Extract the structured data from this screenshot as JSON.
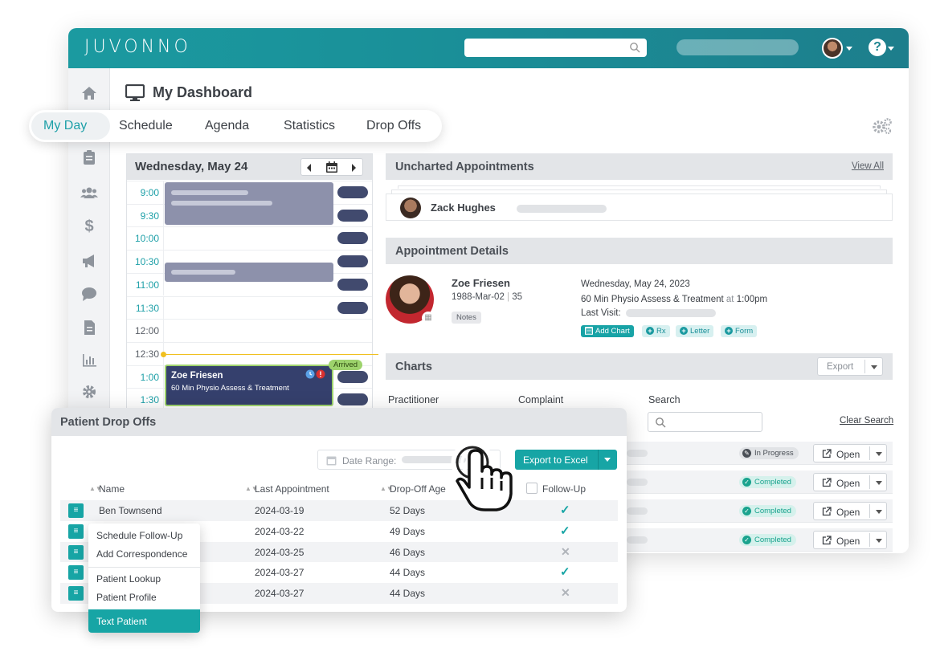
{
  "app": {
    "brand": "JUVONNO",
    "page_title": "My Dashboard",
    "sidebar_icons": [
      "home-icon",
      "calendar-icon",
      "clipboard-icon",
      "users-icon",
      "dollar-icon",
      "megaphone-icon",
      "chat-icon",
      "document-icon",
      "chart-icon",
      "gear-icon"
    ]
  },
  "tabs": [
    "My Day",
    "Schedule",
    "Agenda",
    "Statistics",
    "Drop Offs"
  ],
  "calendar": {
    "date": "Wednesday, May 24",
    "times": [
      "9:00",
      "9:30",
      "10:00",
      "10:30",
      "11:00",
      "11:30",
      "12:00",
      "12:30",
      "1:00",
      "1:30"
    ],
    "appointment": {
      "name": "Zoe Friesen",
      "service": "60 Min Physio Assess & Treatment",
      "status": "Arrived"
    }
  },
  "uncharted": {
    "title": "Uncharted Appointments",
    "view_all": "View All",
    "patient": "Zack Hughes"
  },
  "details": {
    "title": "Appointment Details",
    "name": "Zoe Friesen",
    "dob": "1988-Mar-02",
    "age": "35",
    "notes": "Notes",
    "date": "Wednesday, May 24, 2023",
    "service": "60 Min Physio Assess & Treatment",
    "at": "at",
    "time": "1:00pm",
    "last_visit": "Last Visit:",
    "actions": [
      "Add Chart",
      "Rx",
      "Letter",
      "Form"
    ]
  },
  "charts": {
    "title": "Charts",
    "export": "Export",
    "filters": [
      "Practitioner",
      "Complaint",
      "Search"
    ],
    "clear_search": "Clear Search",
    "rows": [
      {
        "status": "In Progress",
        "action": "Open"
      },
      {
        "status": "Completed",
        "action": "Open"
      },
      {
        "status": "Completed",
        "action": "Open"
      },
      {
        "status": "Completed",
        "action": "Open"
      }
    ]
  },
  "dropoffs": {
    "title": "Patient Drop Offs",
    "date_range_label": "Date Range:",
    "export_btn": "Export to Excel",
    "columns": [
      "Name",
      "Last Appointment",
      "Drop-Off Age",
      "Follow-Up"
    ],
    "rows": [
      {
        "name": "Ben Townsend",
        "last": "2024-03-19",
        "age": "52 Days",
        "follow_up": true
      },
      {
        "name": "",
        "last": "2024-03-22",
        "age": "49 Days",
        "follow_up": true
      },
      {
        "name": "",
        "last": "2024-03-25",
        "age": "46 Days",
        "follow_up": false
      },
      {
        "name": "",
        "last": "2024-03-27",
        "age": "44 Days",
        "follow_up": true
      },
      {
        "name": "",
        "last": "2024-03-27",
        "age": "44 Days",
        "follow_up": false
      }
    ]
  },
  "context_menu": [
    "Schedule Follow-Up",
    "Add Correspondence",
    "Patient Lookup",
    "Patient Profile",
    "Text Patient"
  ],
  "colors": {
    "teal": "#17a5a5",
    "navy": "#35406d",
    "arrived": "#9dd36c"
  }
}
